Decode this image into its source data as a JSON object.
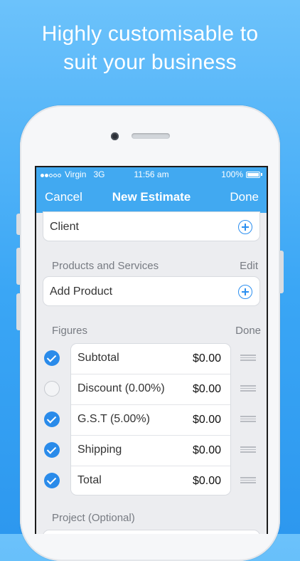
{
  "headline": {
    "line1": "Highly customisable to",
    "line2": "suit your business"
  },
  "status": {
    "carrier": "Virgin",
    "network": "3G",
    "time": "11:56 am",
    "battery": "100%",
    "signal_bars_filled": 2,
    "signal_bars_total": 5
  },
  "nav": {
    "cancel": "Cancel",
    "title": "New Estimate",
    "done": "Done"
  },
  "client": {
    "label": "Client",
    "icon": "plus-circle-icon"
  },
  "products": {
    "section_title": "Products and Services",
    "action": "Edit",
    "add_label": "Add Product",
    "icon": "plus-circle-icon"
  },
  "figures": {
    "section_title": "Figures",
    "action": "Done",
    "rows": [
      {
        "name": "Subtotal",
        "value": "$0.00",
        "checked": true
      },
      {
        "name": "Discount (0.00%)",
        "value": "$0.00",
        "checked": false
      },
      {
        "name": "G.S.T (5.00%)",
        "value": "$0.00",
        "checked": true
      },
      {
        "name": "Shipping",
        "value": "$0.00",
        "checked": true
      },
      {
        "name": "Total",
        "value": "$0.00",
        "checked": true
      }
    ]
  },
  "project": {
    "section_title": "Project (Optional)"
  },
  "colors": {
    "nav_bar": "#41a9f1",
    "accent": "#2a8bea",
    "background_top": "#6cc2fb",
    "background_bottom": "#2d98ef"
  }
}
